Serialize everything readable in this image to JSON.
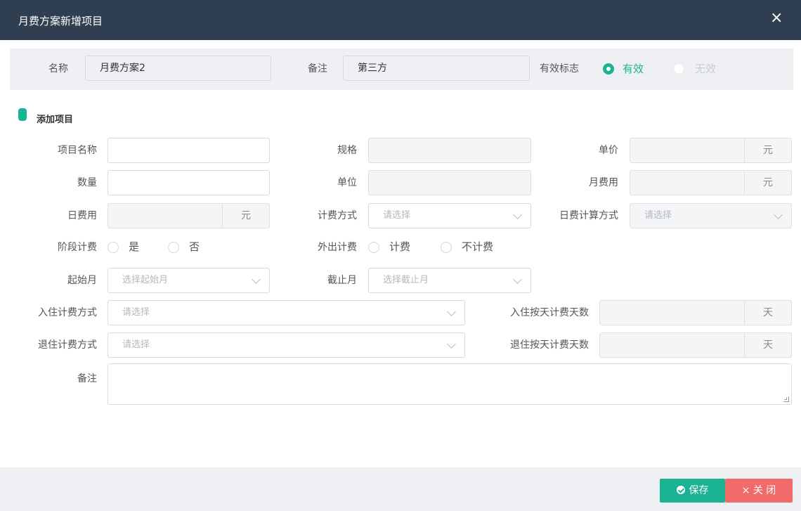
{
  "dialog": {
    "title": "月费方案新增项目",
    "close_icon": "×"
  },
  "plan": {
    "name_label": "名称",
    "name_value": "月费方案2",
    "remark_label": "备注",
    "remark_value": "第三方",
    "valid_label": "有效标志",
    "valid_options": [
      "有效",
      "无效"
    ],
    "valid_selected": "有效"
  },
  "section": {
    "title": "添加项目"
  },
  "form": {
    "item_name_label": "项目名称",
    "item_name_value": "",
    "spec_label": "规格",
    "unit_price_label": "单价",
    "unit_price_addon": "元",
    "qty_label": "数量",
    "qty_value": "",
    "unit_label": "单位",
    "monthly_fee_label": "月费用",
    "monthly_fee_addon": "元",
    "daily_fee_label": "日费用",
    "daily_fee_addon": "元",
    "billing_method_label": "计费方式",
    "billing_method_placeholder": "请选择",
    "daily_calc_label": "日费计算方式",
    "daily_calc_placeholder": "请选择",
    "stage_billing_label": "阶段计费",
    "stage_billing_options": [
      "是",
      "否"
    ],
    "outing_billing_label": "外出计费",
    "outing_billing_options": [
      "计费",
      "不计费"
    ],
    "start_month_label": "起始月",
    "start_month_placeholder": "选择起始月",
    "end_month_label": "截止月",
    "end_month_placeholder": "选择截止月",
    "checkin_method_label": "入住计费方式",
    "checkin_method_placeholder": "请选择",
    "checkin_days_label": "入住按天计费天数",
    "checkin_days_addon": "天",
    "checkout_method_label": "退住计费方式",
    "checkout_method_placeholder": "请选择",
    "checkout_days_label": "退住按天计费天数",
    "checkout_days_addon": "天",
    "remark_label": "备注"
  },
  "footer": {
    "save_label": "保存",
    "close_label": "× 关 闭"
  },
  "colors": {
    "header_bg": "#2f3f51",
    "accent": "#1ab394",
    "danger": "#f26b6b",
    "panel_bg": "#eef0f3"
  }
}
